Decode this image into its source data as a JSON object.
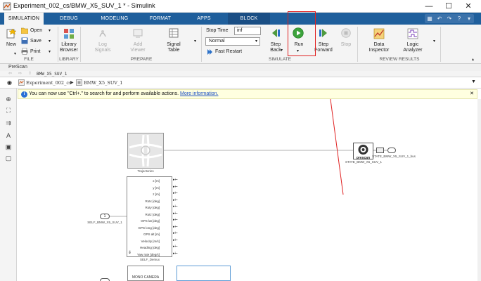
{
  "window": {
    "title": "Experiment_002_cs/BMW_X5_SUV_1 * - Simulink",
    "minimize": "—",
    "maximize": "☐",
    "close": "✕"
  },
  "tabs": [
    "SIMULATION",
    "DEBUG",
    "MODELING",
    "FORMAT",
    "APPS",
    "BLOCK"
  ],
  "active_tab": "SIMULATION",
  "quick_access": [
    "▦",
    "↶",
    "↷",
    "?",
    "▾"
  ],
  "ribbon": {
    "file": {
      "new": "New",
      "open": "Open",
      "save": "Save",
      "print": "Print",
      "label": "FILE"
    },
    "library": {
      "browser": "Library\nBrowser",
      "label": "LIBRARY"
    },
    "prepare": {
      "log_signals": "Log\nSignals",
      "add_viewer": "Add\nViewer",
      "signal_table": "Signal\nTable",
      "label": "PREPARE"
    },
    "simulate": {
      "stop_time_label": "Stop Time",
      "stop_time_value": "inf",
      "mode": "Normal",
      "fast_restart": "Fast Restart",
      "step_back": "Step\nBack",
      "run": "Run",
      "step_forward": "Step\nForward",
      "stop": "Stop",
      "label": "SIMULATE"
    },
    "review": {
      "data_inspector": "Data\nInspector",
      "logic_analyzer": "Logic\nAnalyzer",
      "label": "REVIEW RESULTS"
    }
  },
  "prescan_label": "PreScan",
  "model_tab": "BMW_X5_SUV_1",
  "breadcrumb": {
    "root": "Experiment_002_cs",
    "child": "BMW_X5_SUV_1"
  },
  "banner": {
    "text": "You can now use \"Ctrl+.\" to search for and perform available actions.",
    "link": "More information."
  },
  "canvas": {
    "trajectories": "Trajectories",
    "prescan_block": "prescan",
    "state_block": "STATE_BMW_X5_SUV_1",
    "bus_label": "STATE_BMW_X5_SUV_1_bus",
    "self_inport": "SELF_BMW_X5_SUV_1",
    "demux_label": "SELF_Demux",
    "demux_ports": [
      "x [m]",
      "y [m]",
      "z [m]",
      "Rotx [deg]",
      "Roty [deg]",
      "Rotz [deg]",
      "GPS lat [deg]",
      "GPS long [deg]",
      "GPS alt [m]",
      "Velocity [m/s]",
      "Heading [deg]",
      "Yaw rate [deg/s]"
    ],
    "camera_block": "MONO CAMERA",
    "inport_number": "1"
  }
}
